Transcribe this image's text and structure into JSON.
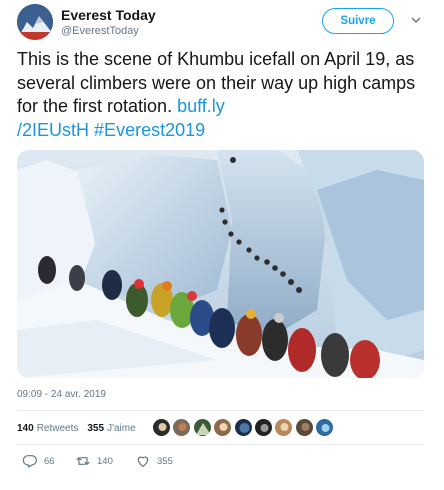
{
  "author": {
    "display_name": "Everest Today",
    "handle": "@EverestToday",
    "follow_label": "Suivre"
  },
  "tweet": {
    "text": "This is the scene of Khumbu icefall on April 19, as several climbers were on their way up high camps for the first rotation.",
    "link": "buff.ly\n/2IEUstH",
    "link_part1": "buff.ly",
    "link_part2": "/2IEUstH",
    "hashtag": "#Everest2019"
  },
  "meta": {
    "timestamp": "09:09 - 24 avr. 2019"
  },
  "stats": {
    "retweets_count": "140",
    "retweets_label": "Retweets",
    "likes_count": "355",
    "likes_label": "J'aime"
  },
  "actions": {
    "reply_count": "66",
    "retweet_count": "140",
    "like_count": "355"
  },
  "colors": {
    "accent": "#1da1f2",
    "link": "#1b95e0",
    "muted": "#657786"
  },
  "icons": {
    "chevron": "chevron-down-icon",
    "reply": "reply-icon",
    "retweet": "retweet-icon",
    "like": "heart-icon"
  }
}
